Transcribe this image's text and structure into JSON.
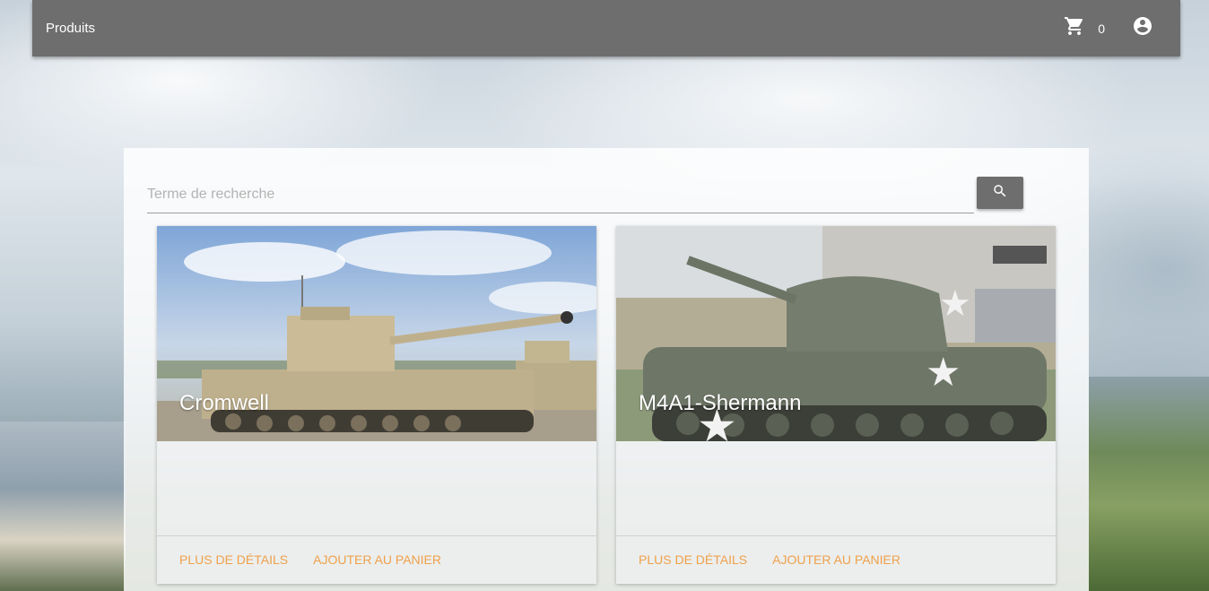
{
  "app_bar": {
    "title": "Produits",
    "cart_icon": "cart-icon",
    "cart_count": "0",
    "account_icon": "account-circle-icon"
  },
  "search": {
    "placeholder": "Terme de recherche",
    "value": "",
    "button_icon": "search-icon"
  },
  "products": [
    {
      "name": "Cromwell",
      "image": "cromwell-tank-photo",
      "actions": [
        "PLUS DE DÉTAILS",
        "AJOUTER AU PANIER"
      ]
    },
    {
      "name": "M4A1-Shermann",
      "image": "sherman-tank-photo",
      "actions": [
        "PLUS DE DÉTAILS",
        "AJOUTER AU PANIER"
      ]
    }
  ],
  "colors": {
    "app_bar": "#6e6e6e",
    "action_text": "#f0a04b"
  }
}
